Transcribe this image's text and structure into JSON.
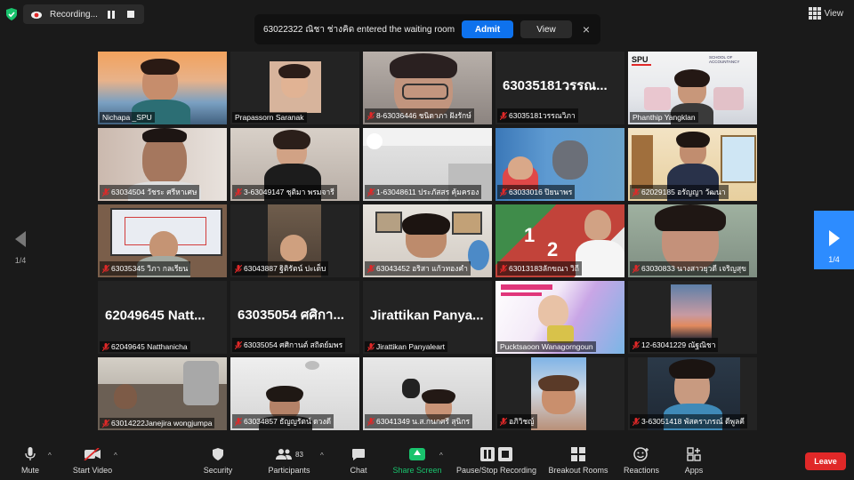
{
  "recording": {
    "status_text": "Recording..."
  },
  "notification": {
    "message": "63022322 ณิชา ช่างคิด entered the waiting room",
    "admit_label": "Admit",
    "view_label": "View",
    "close_glyph": "×"
  },
  "view_menu": {
    "label": "View"
  },
  "pagination": {
    "prev_page": "1/4",
    "next_page": "1/4"
  },
  "participants": [
    {
      "name": "Nichapa _SPU",
      "muted": false,
      "speaking": false
    },
    {
      "name": "Prapassorn Saranak",
      "muted": false,
      "speaking": false
    },
    {
      "name": "8-63036446 ชนิดาภา ฝังรักษ์",
      "muted": true,
      "speaking": false
    },
    {
      "name": "63035181วรรณวิภา",
      "muted": true,
      "speaking": false,
      "big_name": "63035181วรรณ..."
    },
    {
      "name": "Phanthip Yangklan",
      "muted": false,
      "speaking": true,
      "logo_left": "SPU",
      "logo_right": "SCHOOL OF ACCOUNTANCY"
    },
    {
      "name": "63034504 วัชระ ศรีหาเศษ",
      "muted": true,
      "speaking": false
    },
    {
      "name": "3-63049147 ชุติมา พรมจารี",
      "muted": true,
      "speaking": false
    },
    {
      "name": "1-63048611 ประภัสสร คุ้มครอง",
      "muted": true,
      "speaking": false
    },
    {
      "name": "63033016 ปิยนาพร",
      "muted": true,
      "speaking": false
    },
    {
      "name": "62029185 อรัญญา วัฒนา",
      "muted": true,
      "speaking": false
    },
    {
      "name": "63035345 วิภา กลเรียน",
      "muted": true,
      "speaking": false
    },
    {
      "name": "63043887 ฐิติรัตน์ ปะเต็บ",
      "muted": true,
      "speaking": false
    },
    {
      "name": "63043452 อริสา แก้วทองคำ",
      "muted": true,
      "speaking": false
    },
    {
      "name": "63013183ลักขณา วิถี",
      "muted": true,
      "speaking": false
    },
    {
      "name": "63030833 นางสาวยุวดี เจริญสุข",
      "muted": true,
      "speaking": false
    },
    {
      "name": "62049645 Natthanicha",
      "muted": true,
      "speaking": false,
      "big_name": "62049645 Natt..."
    },
    {
      "name": "63035054 ศศิกานต์ สถิตย์มพร",
      "muted": true,
      "speaking": false,
      "big_name": "63035054 ศศิกา..."
    },
    {
      "name": "Jirattikan Panyaleart",
      "muted": true,
      "speaking": false,
      "big_name": "Jirattikan Panya..."
    },
    {
      "name": "Pucktsaoon Wanagorngoun",
      "muted": false,
      "speaking": false
    },
    {
      "name": "12-63041229 ณัฐณิชา",
      "muted": true,
      "speaking": false
    },
    {
      "name": "63014222Janejira wongjumpa",
      "muted": true,
      "speaking": false
    },
    {
      "name": "63034857 ธัญญรัตน์ ดวงดี",
      "muted": true,
      "speaking": false
    },
    {
      "name": "63041349 น.ส.กนกศรี สุนิกร",
      "muted": true,
      "speaking": false
    },
    {
      "name": "อภิวิชญ์",
      "muted": true,
      "speaking": false
    },
    {
      "name": "3-63051418 พัสคราภรณ์ ดีพูลคี",
      "muted": true,
      "speaking": false
    }
  ],
  "toolbar": {
    "mute": "Mute",
    "start_video": "Start Video",
    "security": "Security",
    "participants": "Participants",
    "participants_count": "83",
    "chat": "Chat",
    "share_screen": "Share Screen",
    "pause_stop_recording": "Pause/Stop Recording",
    "breakout_rooms": "Breakout Rooms",
    "reactions": "Reactions",
    "apps": "Apps",
    "leave": "Leave"
  },
  "colors": {
    "accent_blue": "#2d8cff",
    "admit_blue": "#0e72ed",
    "share_green": "#19c36d",
    "leave_red": "#e02828",
    "speaking_outline": "#c8e400"
  }
}
